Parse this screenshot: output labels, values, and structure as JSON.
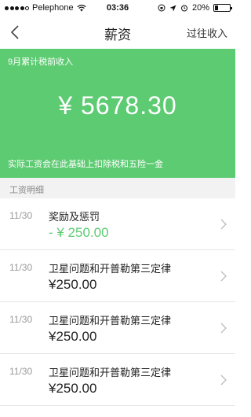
{
  "status_bar": {
    "carrier": "Pelephone",
    "time": "03:36",
    "battery": "20%",
    "battery_level": 0.2
  },
  "nav": {
    "back_icon": "chevron-left-icon",
    "title": "薪资",
    "right_label": "过往收入"
  },
  "hero": {
    "label": "9月累计税前收入",
    "amount": "¥ 5678.30",
    "note": "实际工资会在此基础上扣除税和五险一金",
    "color": "#5dcb72"
  },
  "section": {
    "title": "工资明细"
  },
  "items": [
    {
      "date": "11/30",
      "desc": "奖励及惩罚",
      "amount": "- ¥ 250.00",
      "highlight": true
    },
    {
      "date": "11/30",
      "desc": "卫星问题和开普勒第三定律",
      "amount": "¥250.00",
      "highlight": false
    },
    {
      "date": "11/30",
      "desc": "卫星问题和开普勒第三定律",
      "amount": "¥250.00",
      "highlight": false
    },
    {
      "date": "11/30",
      "desc": "卫星问题和开普勒第三定律",
      "amount": "¥250.00",
      "highlight": false
    }
  ]
}
